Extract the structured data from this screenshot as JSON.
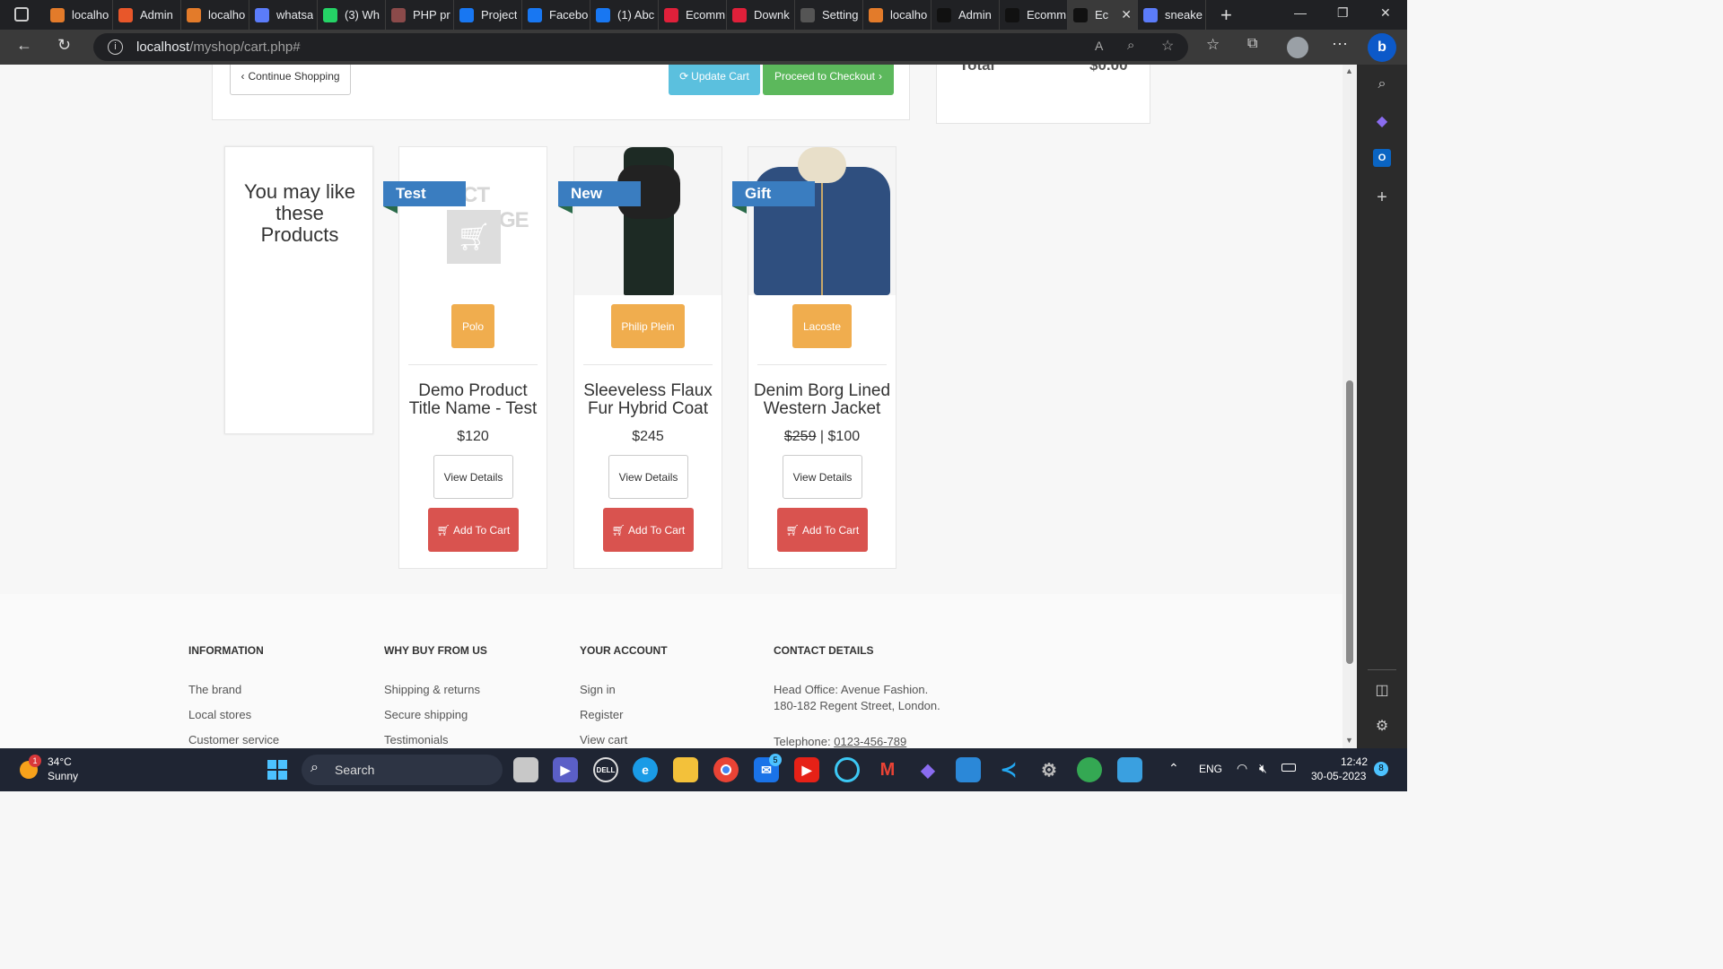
{
  "browser": {
    "tabs": [
      {
        "label": "localho",
        "color": "#e37b2a",
        "icon": "xampp-icon"
      },
      {
        "label": "Admin",
        "color": "#e8572a",
        "icon": "phpmyadmin-icon"
      },
      {
        "label": "localho",
        "color": "#e37b2a",
        "icon": "xampp-icon"
      },
      {
        "label": "whatsa",
        "color": "#5b7cfa",
        "icon": "search-icon"
      },
      {
        "label": "(3) Wh",
        "color": "#25d366",
        "icon": "whatsapp-icon"
      },
      {
        "label": "PHP pr",
        "color": "#8b4a4a",
        "icon": "site-icon"
      },
      {
        "label": "Project",
        "color": "#1877f2",
        "icon": "facebook-icon"
      },
      {
        "label": "Facebo",
        "color": "#1877f2",
        "icon": "facebook-icon"
      },
      {
        "label": "(1) Abc",
        "color": "#1877f2",
        "icon": "facebook-icon"
      },
      {
        "label": "Ecomm",
        "color": "#e0203a",
        "icon": "site-icon"
      },
      {
        "label": "Downk",
        "color": "#e0203a",
        "icon": "site-icon"
      },
      {
        "label": "Setting",
        "color": "#555555",
        "icon": "gear-icon"
      },
      {
        "label": "localho",
        "color": "#e37b2a",
        "icon": "xampp-icon"
      },
      {
        "label": "Admin",
        "color": "#111111",
        "icon": "letter-l-icon"
      },
      {
        "label": "Ecomm",
        "color": "#111111",
        "icon": "letter-l-icon"
      },
      {
        "label": "Ec",
        "color": "#111111",
        "icon": "letter-l-icon"
      },
      {
        "label": "sneake",
        "color": "#5b7cfa",
        "icon": "search-icon"
      }
    ],
    "url_host": "localhost",
    "url_path": "/myshop/cart.php#"
  },
  "cart": {
    "continue_label": "Continue Shopping",
    "update_label": "Update Cart",
    "checkout_label": "Proceed to Checkout",
    "total_label": "Total",
    "total_value": "$0.00"
  },
  "suggestions": {
    "heading": "You may like these Products",
    "products": [
      {
        "ribbon": "Test",
        "brand": "Polo",
        "title": "Demo Product Title Name - Test",
        "old_price": "",
        "price": "$120",
        "details_label": "View Details",
        "cart_label": "Add To Cart",
        "image": "placeholder",
        "placeholder_text": "CT IMAGE"
      },
      {
        "ribbon": "New",
        "brand": "Philip Plein",
        "title": "Sleeveless Flaux Fur Hybrid Coat",
        "old_price": "",
        "price": "$245",
        "details_label": "View Details",
        "cart_label": "Add To Cart",
        "image": "coat"
      },
      {
        "ribbon": "Gift",
        "brand": "Lacoste",
        "title": "Denim Borg Lined Western Jacket",
        "old_price": "$259",
        "price": "$100",
        "details_label": "View Details",
        "cart_label": "Add To Cart",
        "image": "jacket"
      }
    ]
  },
  "footer": {
    "columns": [
      {
        "heading": "INFORMATION",
        "links": [
          "The brand",
          "Local stores",
          "Customer service"
        ]
      },
      {
        "heading": "WHY BUY FROM US",
        "links": [
          "Shipping & returns",
          "Secure shipping",
          "Testimonials"
        ]
      },
      {
        "heading": "YOUR ACCOUNT",
        "links": [
          "Sign in",
          "Register",
          "View cart"
        ]
      }
    ],
    "contact_heading": "CONTACT DETAILS",
    "contact_line1": "Head Office: Avenue Fashion.",
    "contact_line2": "180-182 Regent Street, London.",
    "telephone_label": "Telephone:",
    "telephone": "0123-456-789"
  },
  "taskbar": {
    "weather_temp": "34°C",
    "weather_desc": "Sunny",
    "weather_badge": "1",
    "search_label": "Search",
    "lang": "ENG",
    "time": "12:42",
    "date": "30-05-2023",
    "notif": "8",
    "mail_badge": "5"
  }
}
